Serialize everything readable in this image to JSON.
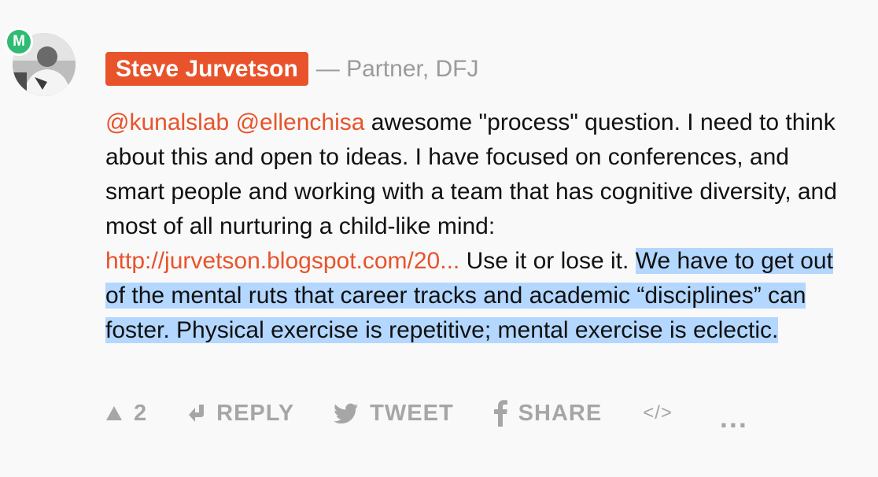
{
  "profile": {
    "badge_letter": "M",
    "avatar_icon": "person-photo",
    "name": "Steve Jurvetson",
    "title": "— Partner, DFJ"
  },
  "comment": {
    "mention_1": "@kunalslab",
    "mention_2": "@ellenchisa",
    "text_1": " awesome \"process\" question. I need to think about this and open to ideas. I have focused on conferences, and smart people and working with a team that has cognitive diversity, and most of all nurturing a child-like mind: ",
    "link": "http://jurvetson.blogspot.com/20...",
    "text_2": " Use it or lose it. ",
    "highlighted": "We have to get out of the mental ruts that career tracks and academic “disciplines” can foster. Physical exercise is repetitive; mental exercise is eclectic."
  },
  "actions": {
    "upvote_count": "2",
    "reply_label": "REPLY",
    "tweet_label": "TWEET",
    "share_label": "SHARE",
    "embed_label": "</>",
    "more_label": "..."
  },
  "colors": {
    "accent": "#e8532b",
    "badge": "#2fbb73",
    "highlight": "#b3d7fe",
    "muted": "#a6a6a6"
  }
}
